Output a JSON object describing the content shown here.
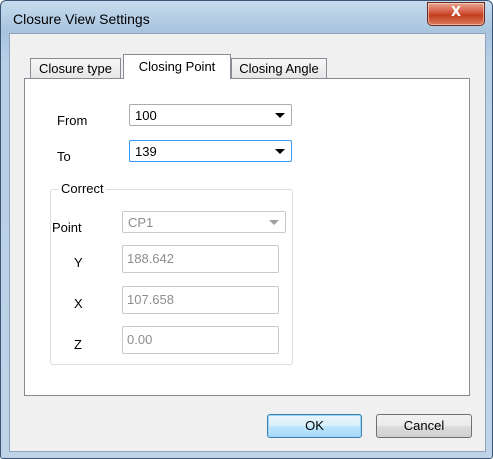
{
  "window": {
    "title": "Closure View Settings",
    "close_glyph": "X"
  },
  "tabs": [
    {
      "label": "Closure type",
      "active": false
    },
    {
      "label": "Closing Point",
      "active": true
    },
    {
      "label": "Closing Angle",
      "active": false
    }
  ],
  "form": {
    "from": {
      "label": "From",
      "value": "100"
    },
    "to": {
      "label": "To",
      "value": "139"
    }
  },
  "correct": {
    "title": "Correct",
    "point": {
      "label": "Point",
      "value": "CP1"
    },
    "y": {
      "label": "Y",
      "value": "188.642"
    },
    "x": {
      "label": "X",
      "value": "107.658"
    },
    "z": {
      "label": "Z",
      "value": "0.00"
    }
  },
  "buttons": {
    "ok": "OK",
    "cancel": "Cancel"
  }
}
